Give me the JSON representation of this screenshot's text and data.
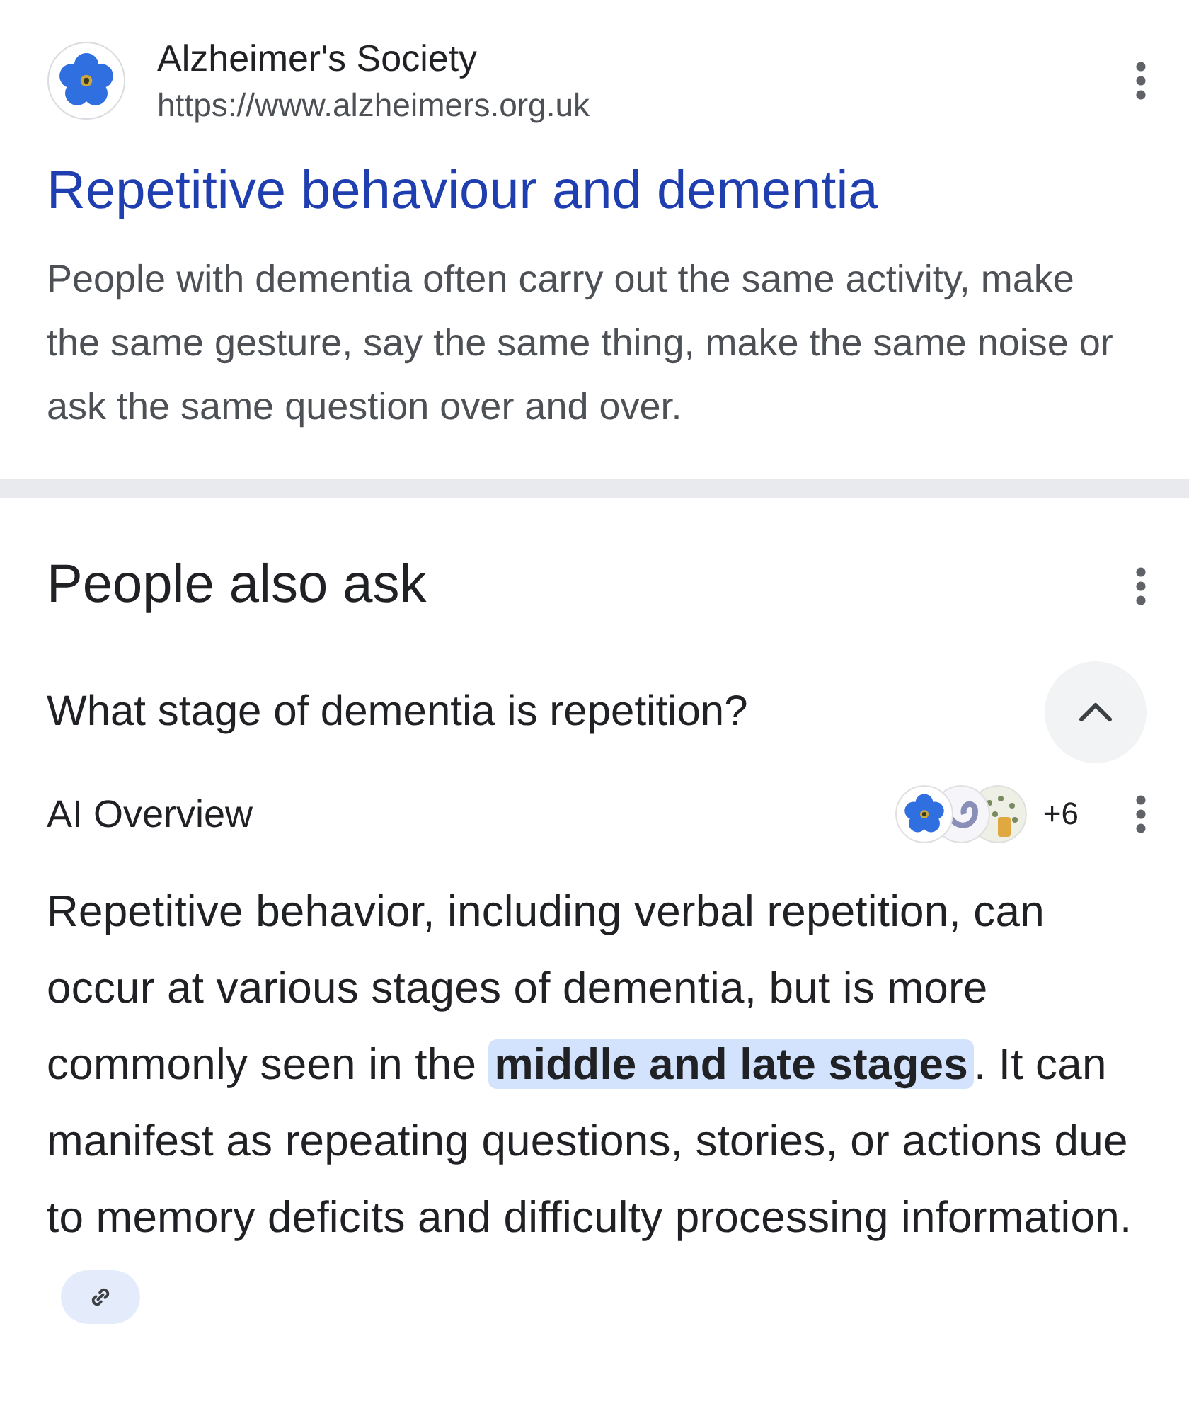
{
  "result": {
    "site_name": "Alzheimer's Society",
    "url": "https://www.alzheimers.org.uk",
    "title": "Repetitive behaviour and dementia",
    "snippet": "People with dementia often carry out the same activity, make the same gesture, say the same thing, make the same noise or ask the same question over and over."
  },
  "people_also_ask": {
    "heading": "People also ask",
    "question": {
      "text": "What stage of dementia is repetition?",
      "expanded": true
    },
    "ai_overview": {
      "label": "AI Overview",
      "more_sources": "+6",
      "text": "Repetitive behavior, including verbal repetition, can occur at various stages of dementia, but is more commonly seen in the **middle and late stages**. It can manifest as repeating questions, stories, or actions due to memory deficits and difficulty processing information."
    }
  }
}
